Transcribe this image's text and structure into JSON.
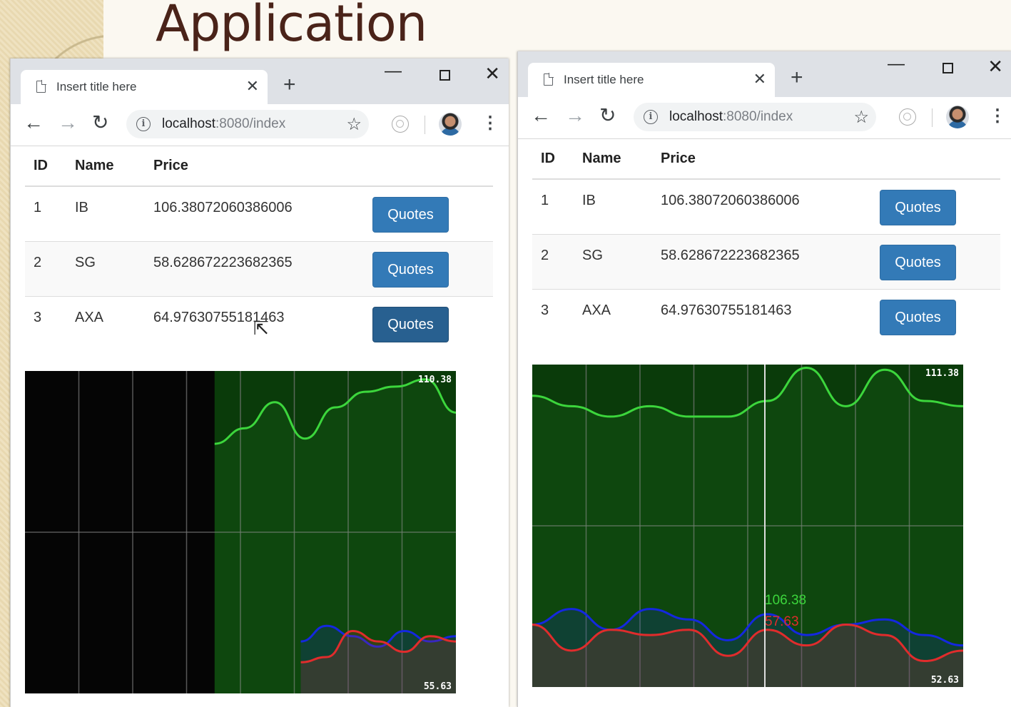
{
  "slide": {
    "title": "Application"
  },
  "browsers": [
    {
      "tab_title": "Insert title here",
      "url_host": "localhost",
      "url_rest": ":8080/index",
      "table": {
        "headers": [
          "ID",
          "Name",
          "Price",
          ""
        ],
        "rows": [
          {
            "id": "1",
            "name": "IB",
            "price": "106.38072060386006",
            "button": "Quotes"
          },
          {
            "id": "2",
            "name": "SG",
            "price": "58.628672223682365",
            "button": "Quotes"
          },
          {
            "id": "3",
            "name": "AXA",
            "price": "64.97630755181463",
            "button": "Quotes"
          }
        ]
      },
      "chart_data": {
        "type": "area",
        "max_label": "110.38",
        "min_label": "55.63",
        "series": [
          {
            "color": "#3cd63c",
            "values": [
              98,
              101,
              106,
              99,
              105,
              108,
              109,
              110.38,
              104
            ]
          },
          {
            "color": "#1428e0",
            "values": [
              60,
              63,
              61,
              59,
              62,
              60,
              61
            ]
          },
          {
            "color": "#e02c2c",
            "values": [
              56,
              57,
              62,
              60,
              58,
              61,
              60
            ]
          }
        ]
      }
    },
    {
      "tab_title": "Insert title here",
      "url_host": "localhost",
      "url_rest": ":8080/index",
      "table": {
        "headers": [
          "ID",
          "Name",
          "Price",
          ""
        ],
        "rows": [
          {
            "id": "1",
            "name": "IB",
            "price": "106.38072060386006",
            "button": "Quotes"
          },
          {
            "id": "2",
            "name": "SG",
            "price": "58.628672223682365",
            "button": "Quotes"
          },
          {
            "id": "3",
            "name": "AXA",
            "price": "64.97630755181463",
            "button": "Quotes"
          }
        ]
      },
      "chart_data": {
        "type": "area",
        "max_label": "111.38",
        "min_label": "52.63",
        "tooltip": [
          "106.38",
          "57.63"
        ],
        "series": [
          {
            "color": "#3cd63c",
            "values": [
              106,
              104,
              102,
              104,
              102,
              102,
              105,
              111.38,
              104,
              111,
              105,
              104
            ]
          },
          {
            "color": "#1428e0",
            "values": [
              62,
              65,
              61,
              65,
              63,
              59,
              64,
              60,
              62,
              63,
              60,
              58
            ]
          },
          {
            "color": "#e02c2c",
            "values": [
              62,
              57,
              61,
              60,
              61,
              56,
              61,
              58,
              62,
              60,
              55,
              57
            ]
          }
        ]
      }
    }
  ]
}
